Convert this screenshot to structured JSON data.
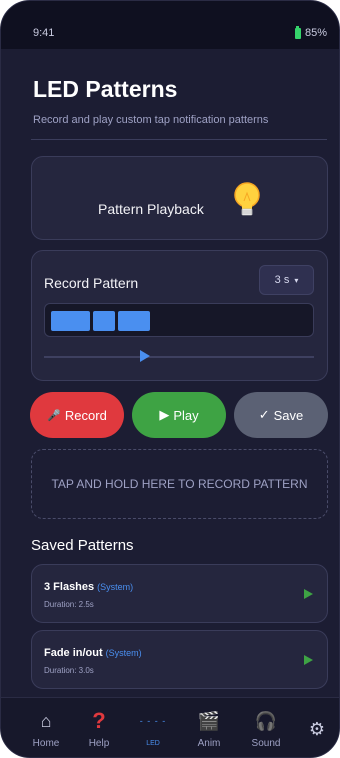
{
  "status": {
    "time": "9:41",
    "battery": "85%"
  },
  "header": {
    "title": "LED Patterns",
    "subtitle": "Record and play custom tap notification patterns"
  },
  "playback": {
    "label": "Pattern Playback",
    "icon": "lightbulb-icon"
  },
  "record": {
    "label": "Record Pattern",
    "duration_value": "3 s",
    "duration_caret": "▾",
    "scrub_progress": 0.35
  },
  "buttons": {
    "record": {
      "icon": "🎤",
      "label": "Record"
    },
    "play": {
      "icon": "▶",
      "label": "Play"
    },
    "save": {
      "icon": "✓",
      "label": "Save"
    }
  },
  "tap_area": {
    "label": "TAP AND HOLD HERE TO RECORD PATTERN"
  },
  "saved": {
    "title": "Saved Patterns",
    "items": [
      {
        "name": "3 Flashes",
        "tag": "(System)",
        "duration": "Duration: 2.5s"
      },
      {
        "name": "Fade in/out",
        "tag": "(System)",
        "duration": "Duration: 3.0s"
      }
    ]
  },
  "nav": {
    "items": [
      {
        "icon": "⌂",
        "label": "Home"
      },
      {
        "icon": "?",
        "label": "Help"
      },
      {
        "icon": "- - - -",
        "label": "LED"
      },
      {
        "icon": "🎬",
        "label": "Anim"
      },
      {
        "icon": "🎧",
        "label": "Sound"
      },
      {
        "icon": "⚙",
        "label": ""
      }
    ]
  },
  "colors": {
    "accent": "#4a8ff0",
    "record": "#e0393e",
    "play": "#3ea344",
    "save": "#5b6174",
    "background": "#1c1d33",
    "help": "#e0393e"
  }
}
